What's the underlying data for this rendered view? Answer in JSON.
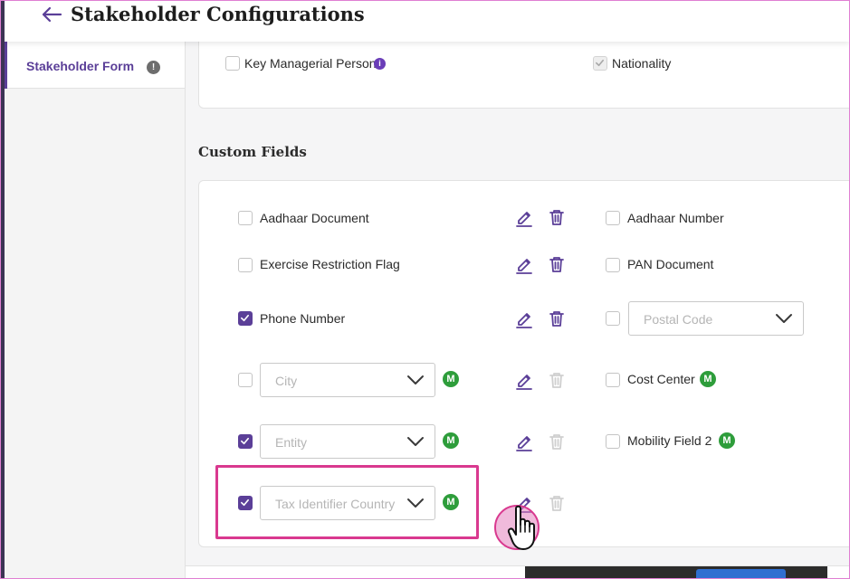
{
  "header": {
    "title": "Stakeholder Configurations",
    "back_icon": "arrow-left-icon"
  },
  "sidebar": {
    "items": [
      {
        "label": "Stakeholder Form",
        "badge": "!",
        "active": true
      }
    ]
  },
  "standard_fields": {
    "key_managerial_person": {
      "label": "Key Managerial Person",
      "checked": false,
      "info_badge": "i"
    },
    "nationality": {
      "label": "Nationality",
      "checked": true,
      "disabled": true
    }
  },
  "custom_fields": {
    "heading": "Custom Fields",
    "left": [
      {
        "type": "checkbox",
        "label": "Aadhaar Document",
        "checked": false,
        "delete_enabled": true
      },
      {
        "type": "checkbox",
        "label": "Exercise Restriction Flag",
        "checked": false,
        "delete_enabled": true
      },
      {
        "type": "checkbox",
        "label": "Phone Number",
        "checked": true,
        "delete_enabled": true
      },
      {
        "type": "dropdown",
        "placeholder": "City",
        "checked": false,
        "mandatory_badge": "M",
        "delete_enabled": false
      },
      {
        "type": "dropdown",
        "placeholder": "Entity",
        "checked": true,
        "mandatory_badge": "M",
        "delete_enabled": false
      },
      {
        "type": "dropdown",
        "placeholder": "Tax Identifier Country",
        "checked": true,
        "mandatory_badge": "M",
        "delete_enabled": false,
        "highlighted": true
      }
    ],
    "right": [
      {
        "type": "checkbox",
        "label": "Aadhaar Number",
        "checked": false
      },
      {
        "type": "checkbox",
        "label": "PAN Document",
        "checked": false
      },
      {
        "type": "dropdown",
        "placeholder": "Postal Code",
        "checked": false
      },
      {
        "type": "checkbox",
        "label": "Cost Center",
        "checked": false,
        "mandatory_badge": "M"
      },
      {
        "type": "checkbox",
        "label": "Mobility Field 2",
        "checked": false,
        "mandatory_badge": "M"
      }
    ]
  },
  "colors": {
    "accent": "#5b3f98",
    "mandatory_badge": "#2e9d3b",
    "highlight": "#d9398f",
    "disabled_icon": "#cfcfcf"
  },
  "icons": {
    "edit": "pencil-edit-icon",
    "delete": "trash-icon",
    "dropdown": "chevron-down-icon",
    "check": "checkmark-icon",
    "cursor": "hand-pointer-icon"
  }
}
